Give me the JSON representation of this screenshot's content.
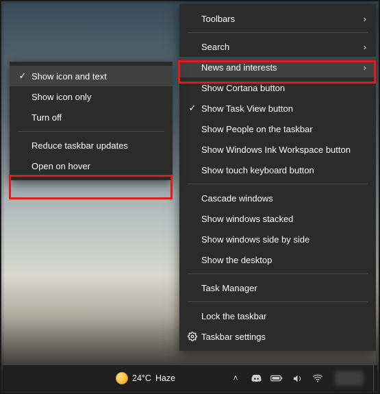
{
  "main_menu": {
    "toolbars": "Toolbars",
    "search": "Search",
    "news": "News and interests",
    "cortana": "Show Cortana button",
    "taskview": "Show Task View button",
    "people": "Show People on the taskbar",
    "ink": "Show Windows Ink Workspace button",
    "touchkbd": "Show touch keyboard button",
    "cascade": "Cascade windows",
    "stacked": "Show windows stacked",
    "sidebyside": "Show windows side by side",
    "desktop": "Show the desktop",
    "taskmgr": "Task Manager",
    "lock": "Lock the taskbar",
    "settings": "Taskbar settings"
  },
  "sub_menu": {
    "icon_text": "Show icon and text",
    "icon_only": "Show icon only",
    "turn_off": "Turn off",
    "reduce": "Reduce taskbar updates",
    "open_hover": "Open on hover"
  },
  "taskbar": {
    "temp": "24°C",
    "cond": "Haze"
  },
  "glyphs": {
    "check": "✓",
    "arrow": "›",
    "caret_up": "˄"
  }
}
